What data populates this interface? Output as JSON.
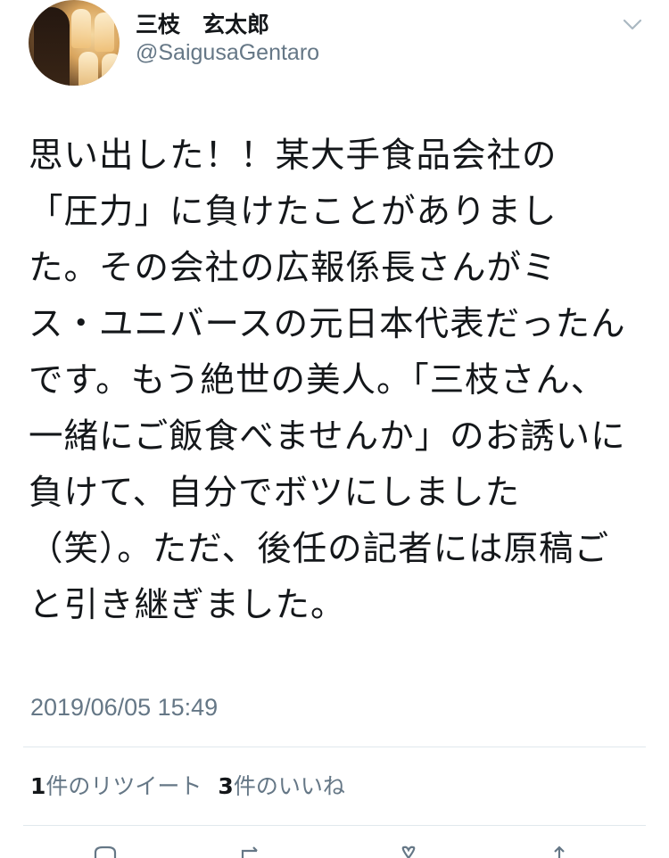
{
  "profile": {
    "display_name": "三枝　玄太郎",
    "handle": "@SaigusaGentaro"
  },
  "tweet": {
    "text": "思い出した！！某大手食品会社の「圧力」に負けたことがありました。その会社の広報係長さんがミス・ユニバースの元日本代表だったんです。もう絶世の美人。「三枝さん、一緒にご飯食べませんか」のお誘いに負けて、自分でボツにしました（笑）。ただ、後任の記者には原稿ごと引き継ぎました。",
    "timestamp": "2019/06/05 15:49"
  },
  "stats": {
    "retweets_count": "1",
    "retweets_label": "件のリツイート",
    "likes_count": "3",
    "likes_label": "件のいいね"
  },
  "icons": {
    "menu": "chevron-down-icon",
    "actions": [
      "reply-icon",
      "retweet-icon",
      "like-icon",
      "share-icon"
    ]
  },
  "colors": {
    "text": "#14171a",
    "secondary": "#657786",
    "divider": "#e1e8ed"
  }
}
